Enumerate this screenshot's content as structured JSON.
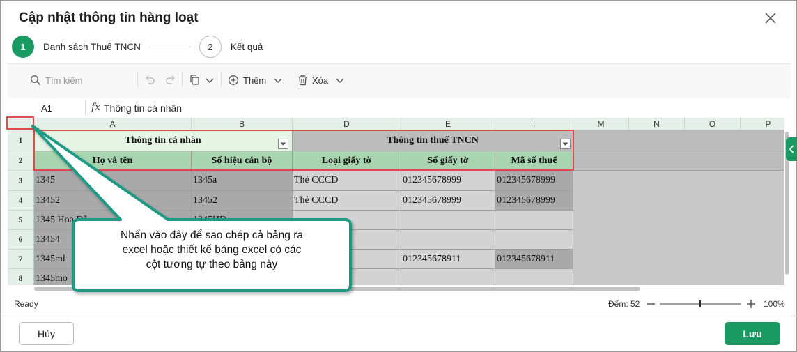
{
  "dialog": {
    "title": "Cập nhật thông tin hàng loạt"
  },
  "steps": [
    {
      "number": "1",
      "label": "Danh sách Thuế TNCN"
    },
    {
      "number": "2",
      "label": "Kết quả"
    }
  ],
  "toolbar": {
    "search_placeholder": "Tìm kiếm",
    "add_label": "Thêm",
    "delete_label": "Xóa"
  },
  "formula": {
    "cell_ref": "A1",
    "fx": "fx",
    "value": "Thông tin cá nhân"
  },
  "sheet": {
    "columns": [
      "A",
      "B",
      "D",
      "E",
      "I",
      "M",
      "N",
      "O",
      "P"
    ],
    "rows": [
      "1",
      "2",
      "3",
      "4",
      "5",
      "6",
      "7",
      "8"
    ],
    "group_headers": [
      "Thông tin cá nhân",
      "Thông tin thuế TNCN"
    ],
    "sub_headers": [
      "Họ và tên",
      "Số hiệu cán bộ",
      "Loại giấy tờ",
      "Số giấy tờ",
      "Mã số thuế"
    ],
    "data": [
      [
        "1345",
        "1345a",
        "Thẻ CCCD",
        "012345678999",
        "012345678999"
      ],
      [
        "13452",
        "13452",
        "Thẻ CCCD",
        "012345678999",
        "012345678999"
      ],
      [
        "1345 Hoa Đồ",
        "1345HD",
        "",
        "",
        ""
      ],
      [
        "13454",
        "",
        "",
        "",
        ""
      ],
      [
        "1345ml",
        "",
        "",
        "012345678911",
        "012345678911"
      ],
      [
        "1345mo",
        "",
        "",
        "",
        ""
      ]
    ]
  },
  "callout": {
    "lines": [
      "Nhấn vào đây để sao chép cả bảng ra",
      "excel hoặc thiết kế bảng excel có các",
      "cột tương tự theo bảng này"
    ]
  },
  "status": {
    "ready": "Ready",
    "count": "Đếm: 52",
    "zoom": "100%"
  },
  "footer": {
    "cancel_label": "Hủy",
    "save_label": "Lưu"
  },
  "colors": {
    "accent": "#1a9a63",
    "highlight_red": "#e04a4a",
    "callout_border": "#1a9a84"
  }
}
